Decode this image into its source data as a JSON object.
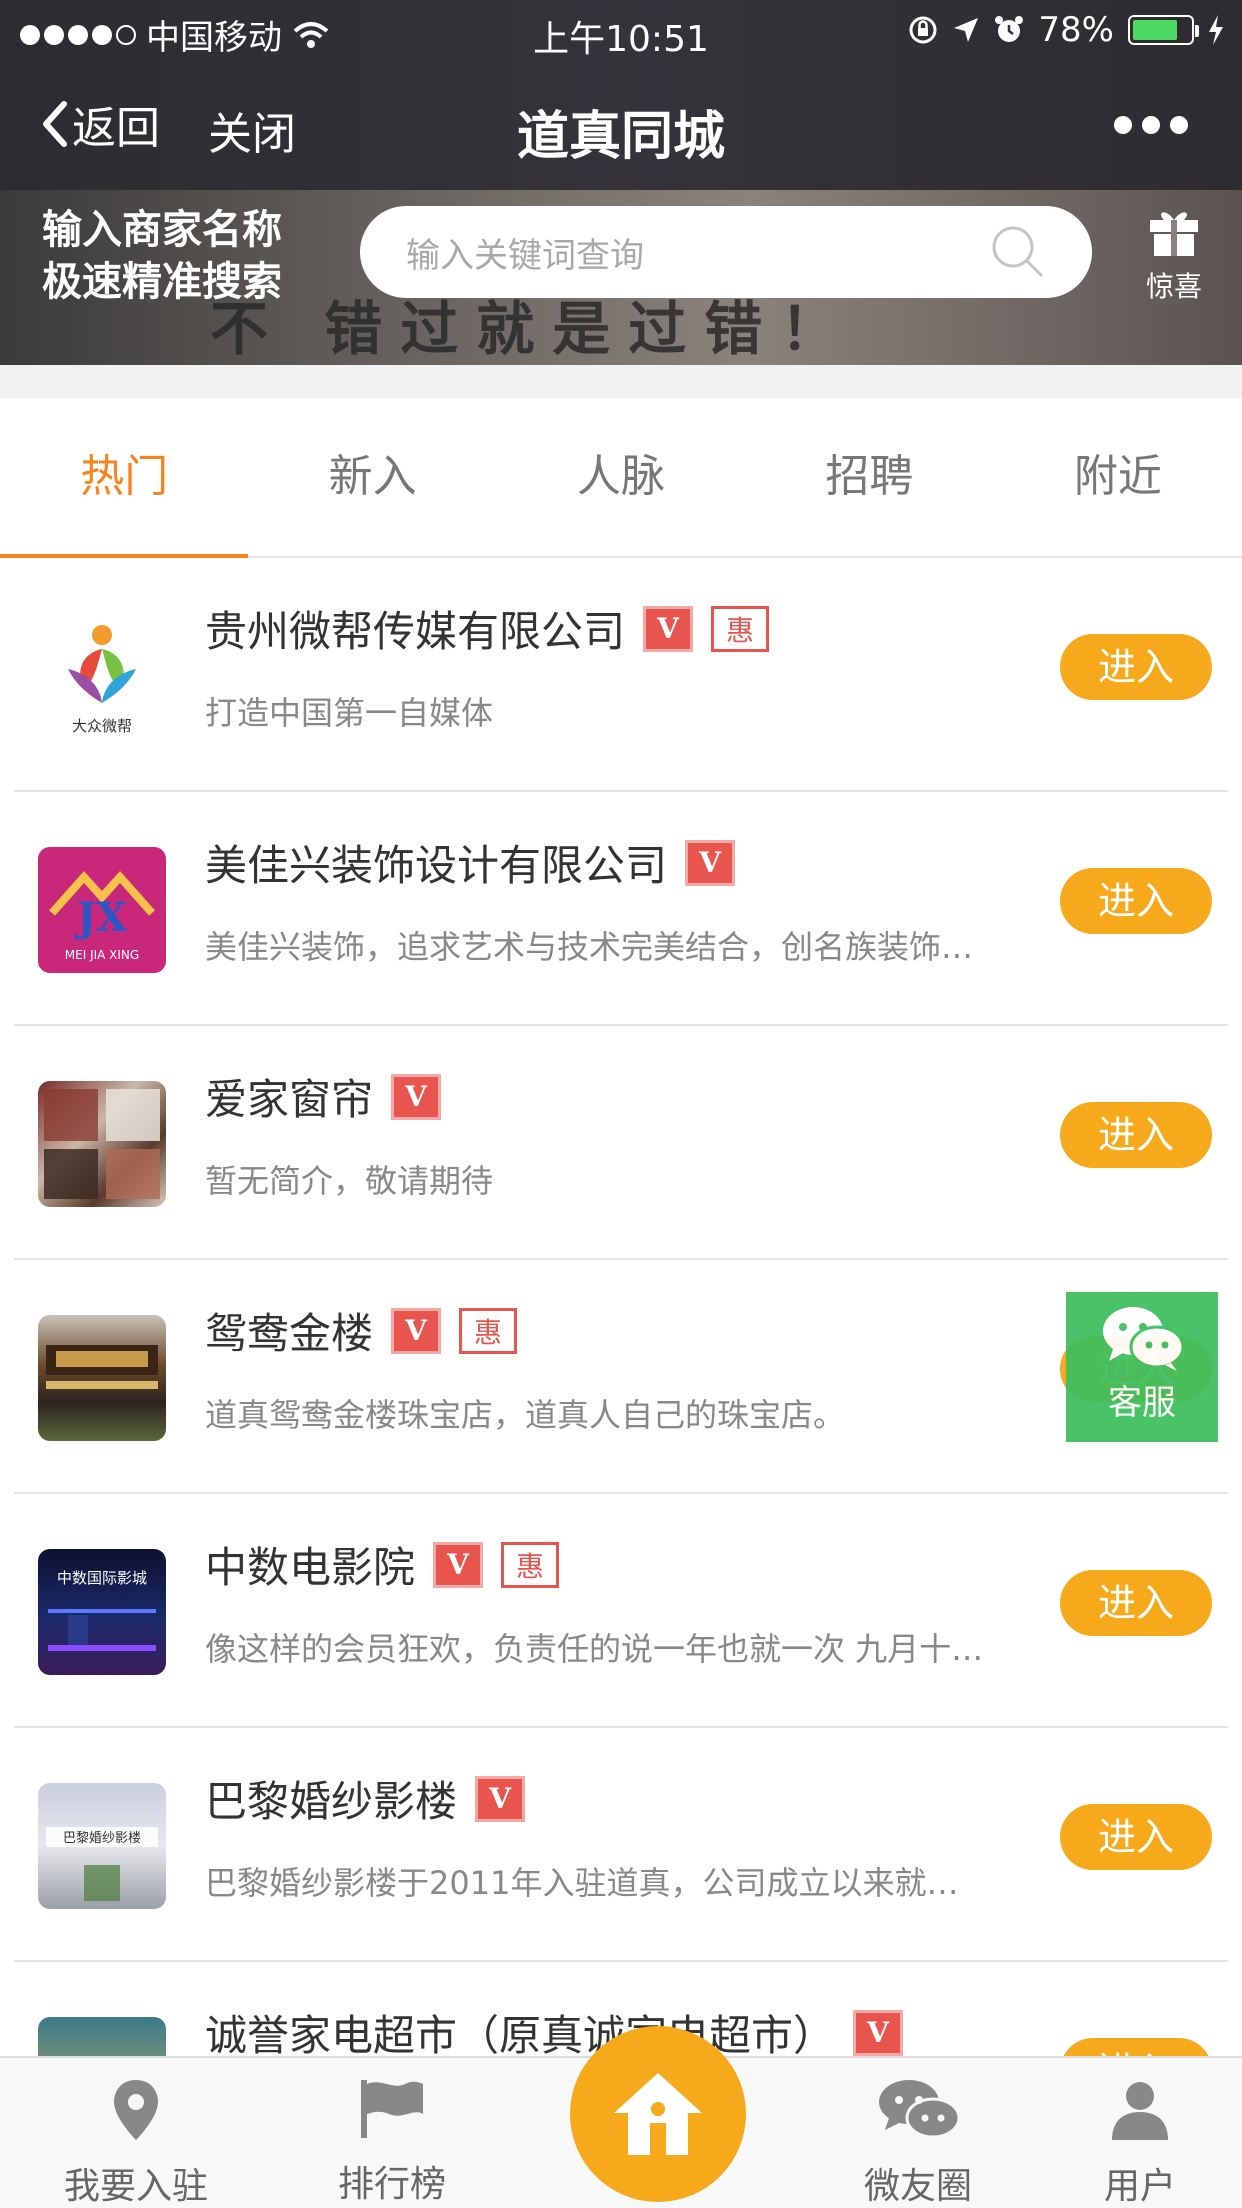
{
  "status_bar": {
    "carrier": "中国移动",
    "time": "上午10:51",
    "battery": "78%"
  },
  "nav": {
    "back_label": "返回",
    "close_label": "关闭",
    "title": "道真同城"
  },
  "banner": {
    "slogan_line1": "输入商家名称",
    "slogan_line2": "极速精准搜索",
    "background_text": "不 错过就是过错！",
    "search_placeholder": "输入关键词查询",
    "gift_label": "惊喜"
  },
  "tabs": [
    {
      "label": "热门",
      "active": true
    },
    {
      "label": "新入",
      "active": false
    },
    {
      "label": "人脉",
      "active": false
    },
    {
      "label": "招聘",
      "active": false
    },
    {
      "label": "附近",
      "active": false
    }
  ],
  "badges": {
    "v": "V",
    "hui": "惠"
  },
  "items": [
    {
      "name": "贵州微帮传媒有限公司",
      "desc": "打造中国第一自媒体",
      "v": true,
      "hui": true,
      "thumb_text": "大众微帮",
      "enter": "进入"
    },
    {
      "name": "美佳兴装饰设计有限公司",
      "desc": "美佳兴装饰，追求艺术与技术完美结合，创名族装饰…",
      "v": true,
      "hui": false,
      "thumb_text": "MEI JIA XING",
      "enter": "进入"
    },
    {
      "name": "爱家窗帘",
      "desc": "暂无简介，敬请期待",
      "v": true,
      "hui": false,
      "thumb_text": "",
      "enter": "进入"
    },
    {
      "name": "鸳鸯金楼",
      "desc": "道真鸳鸯金楼珠宝店，道真人自己的珠宝店。",
      "v": true,
      "hui": true,
      "thumb_text": "",
      "enter": "进入"
    },
    {
      "name": "中数电影院",
      "desc": "像这样的会员狂欢，负责任的说一年也就一次 九月十…",
      "v": true,
      "hui": true,
      "thumb_text": "中数国际影城",
      "enter": "进入"
    },
    {
      "name": "巴黎婚纱影楼",
      "desc": "巴黎婚纱影楼于2011年入驻道真，公司成立以来就…",
      "v": true,
      "hui": false,
      "thumb_text": "巴黎婚纱影楼",
      "enter": "进入"
    },
    {
      "name": "诚誉家电超市（原真诚家电超市）",
      "desc": "",
      "v": true,
      "hui": false,
      "thumb_text": "",
      "enter": "进入"
    }
  ],
  "kefu_label": "客服",
  "tabbar": [
    {
      "label": "我要入驻",
      "icon": "location-pin-icon"
    },
    {
      "label": "排行榜",
      "icon": "flag-icon"
    },
    {
      "label": "",
      "icon": "home-icon"
    },
    {
      "label": "微友圈",
      "icon": "chat-bubbles-icon"
    },
    {
      "label": "用户",
      "icon": "user-icon"
    }
  ],
  "colors": {
    "accent": "#f7841c",
    "enter_button": "#f5a91b",
    "badge_red": "#e8554f",
    "kefu_green": "#3fbf5e"
  }
}
